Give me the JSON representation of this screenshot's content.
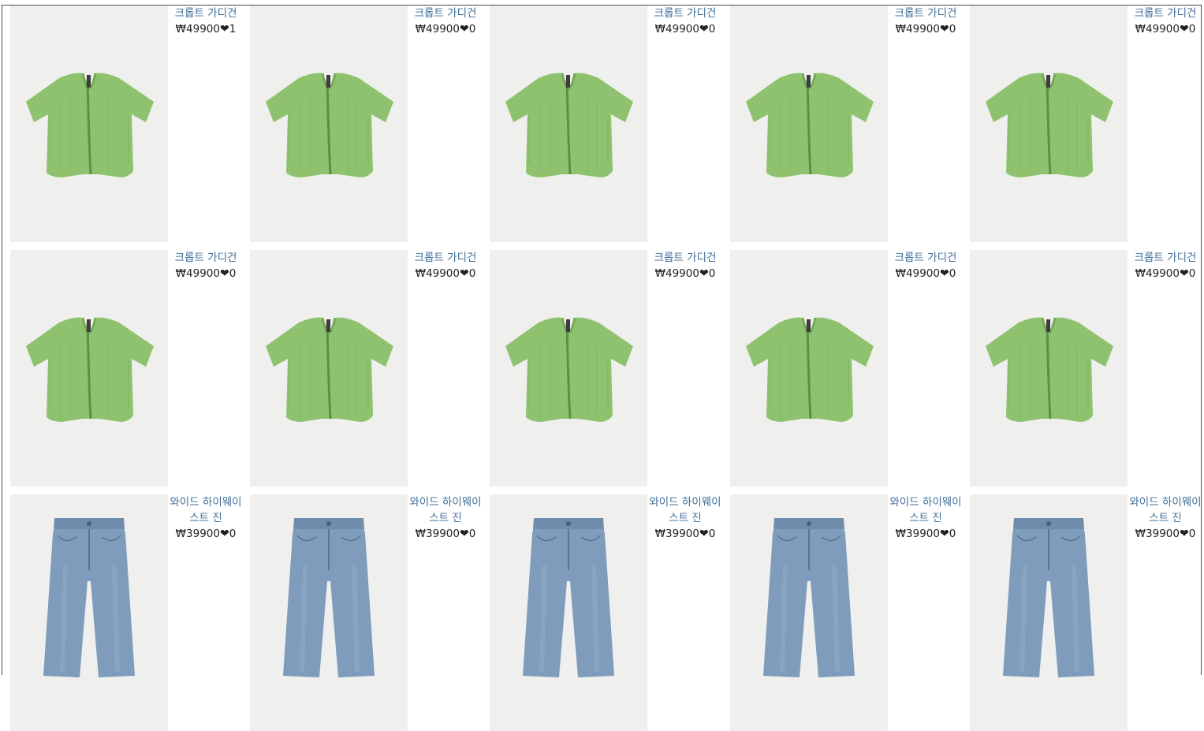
{
  "currency": "₩",
  "heart_glyph": "❤",
  "rows": [
    {
      "items": [
        {
          "name": "크롭트 가디건",
          "price": "49900",
          "likes": "1",
          "image": "green-cardigan"
        },
        {
          "name": "크롭트 가디건",
          "price": "49900",
          "likes": "0",
          "image": "green-cardigan"
        },
        {
          "name": "크롭트 가디건",
          "price": "49900",
          "likes": "0",
          "image": "green-cardigan"
        },
        {
          "name": "크롭트 가디건",
          "price": "49900",
          "likes": "0",
          "image": "green-cardigan"
        },
        {
          "name": "크롭트 가디건",
          "price": "49900",
          "likes": "0",
          "image": "green-cardigan"
        }
      ]
    },
    {
      "items": [
        {
          "name": "크롭트 가디건",
          "price": "49900",
          "likes": "0",
          "image": "green-cardigan"
        },
        {
          "name": "크롭트 가디건",
          "price": "49900",
          "likes": "0",
          "image": "green-cardigan"
        },
        {
          "name": "크롭트 가디건",
          "price": "49900",
          "likes": "0",
          "image": "green-cardigan"
        },
        {
          "name": "크롭트 가디건",
          "price": "49900",
          "likes": "0",
          "image": "green-cardigan"
        },
        {
          "name": "크롭트 가디건",
          "price": "49900",
          "likes": "0",
          "image": "green-cardigan"
        }
      ]
    },
    {
      "items": [
        {
          "name": "와이드 하이웨이스트 진",
          "price": "39900",
          "likes": "0",
          "image": "blue-jeans"
        },
        {
          "name": "와이드 하이웨이스트 진",
          "price": "39900",
          "likes": "0",
          "image": "blue-jeans"
        },
        {
          "name": "와이드 하이웨이스트 진",
          "price": "39900",
          "likes": "0",
          "image": "blue-jeans"
        },
        {
          "name": "와이드 하이웨이스트 진",
          "price": "39900",
          "likes": "0",
          "image": "blue-jeans"
        },
        {
          "name": "와이드 하이웨이스트 진",
          "price": "39900",
          "likes": "0",
          "image": "blue-jeans"
        }
      ]
    }
  ],
  "colors": {
    "name_link": "#3f6d98",
    "price_text": "#222222",
    "image_bg": "#efefed",
    "cardigan_green": "#8fc26f",
    "jeans_blue": "#7f9cbc"
  }
}
